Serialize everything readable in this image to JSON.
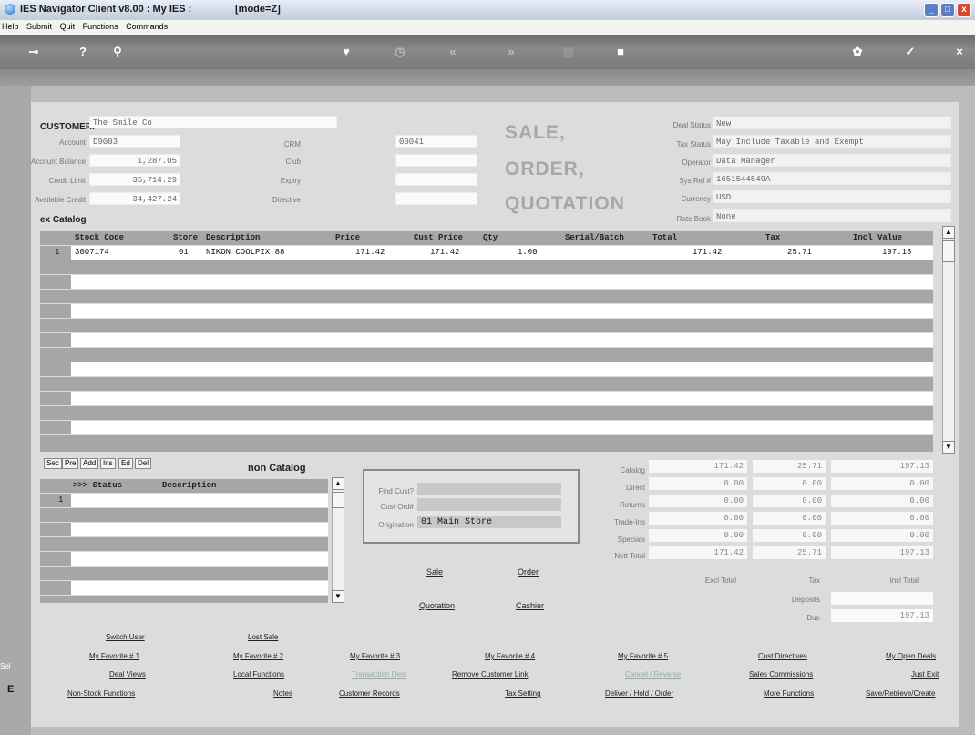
{
  "window": {
    "title": "IES Navigator Client v8.00 : My IES :",
    "mode": "[mode=Z]"
  },
  "menu": [
    "Help",
    "Submit",
    "Quit",
    "Functions",
    "Commands"
  ],
  "toolbar_icons": [
    "key-icon",
    "help-icon",
    "search-icon",
    "heart-icon",
    "clock-icon",
    "first-icon",
    "last-icon",
    "grid-icon",
    "stop-icon",
    "settings-icon",
    "confirm-icon",
    "close-icon"
  ],
  "header": {
    "customer_label": "CUSTOMER:",
    "customer_name": "The Smile Co",
    "account_label": "Account",
    "account": "D9003",
    "account_balance_label": "Account Balance",
    "account_balance": "1,287.05",
    "credit_limit_label": "Credit Limit",
    "credit_limit": "35,714.29",
    "available_credit_label": "Available Credit",
    "available_credit": "34,427.24",
    "crm_label": "CRM",
    "crm": "00041",
    "club_label": "Club",
    "club": "",
    "expiry_label": "Expiry",
    "expiry": "",
    "directive_label": "Directive",
    "directive": "",
    "title_lines": [
      "SALE,",
      "ORDER,",
      "QUOTATION"
    ],
    "deal_status_label": "Deal Status",
    "deal_status": "New",
    "tax_status_label": "Tax Status",
    "tax_status": "May Include Taxable and Exempt",
    "operator_label": "Operator",
    "operator": "Data Manager",
    "sysref_label": "Sys Ref #",
    "sysref": "1651544549A",
    "currency_label": "Currency",
    "currency": "USD",
    "ratebook_label": "Rate Book",
    "ratebook": "None"
  },
  "catalog": {
    "section_label": "ex Catalog",
    "columns": [
      "Stock Code",
      "Store",
      "Description",
      "Price",
      "Cust Price",
      "Qty",
      "Serial/Batch",
      "Total",
      "Tax",
      "Incl Value"
    ],
    "rows": [
      {
        "num": "1",
        "stock_code": "3007174",
        "store": "01",
        "description": "NIKON COOLPIX 88",
        "price": "171.42",
        "cust_price": "171.42",
        "qty": "1.00",
        "serial": "",
        "total": "171.42",
        "tax": "25.71",
        "incl": "197.13"
      }
    ]
  },
  "row_buttons": [
    "Sec",
    "Pre",
    "Add",
    "Ins",
    "Ed",
    "Del"
  ],
  "non_catalog": {
    "section_label": "non Catalog",
    "columns": [
      ">>> Status",
      "Description"
    ],
    "rows": [
      {
        "num": "1",
        "status": "",
        "description": ""
      }
    ]
  },
  "find": {
    "find_cust_label": "Find Cust?",
    "find_cust": "",
    "cust_ord_label": "Cust Ord#",
    "cust_ord": "",
    "origination_label": "Origination",
    "origination": "01 Main Store"
  },
  "actions": {
    "sale": "Sale",
    "order": "Order",
    "quotation": "Quotation",
    "cashier": "Cashier"
  },
  "totals": {
    "rows": [
      {
        "label": "Catalog",
        "excl": "171.42",
        "tax": "25.71",
        "incl": "197.13"
      },
      {
        "label": "Direct",
        "excl": "0.00",
        "tax": "0.00",
        "incl": "0.00"
      },
      {
        "label": "Returns",
        "excl": "0.00",
        "tax": "0.00",
        "incl": "0.00"
      },
      {
        "label": "Trade-Ins",
        "excl": "0.00",
        "tax": "0.00",
        "incl": "0.00"
      },
      {
        "label": "Specials",
        "excl": "0.00",
        "tax": "0.00",
        "incl": "0.00"
      },
      {
        "label": "Nett Total",
        "excl": "171.42",
        "tax": "25.71",
        "incl": "197.13"
      }
    ],
    "excl_label": "Excl Total",
    "tax_label": "Tax",
    "incl_label": "Incl Total",
    "deposits_label": "Deposits",
    "deposits": "",
    "due_label": "Due",
    "due": "197.13"
  },
  "links": {
    "r1": [
      "Switch User",
      "Lost Sale"
    ],
    "r2": [
      "My Favorite # 1",
      "My Favorite # 2",
      "My Favorite # 3",
      "My Favorite # 4",
      "My Favorite # 5",
      "Cust Directives",
      "My Open Deals"
    ],
    "r3": [
      "Deal Views",
      "Local Functions",
      "Transaction Dets",
      "Remove Customer Link",
      "Cancel / Reverse",
      "Sales Commissions",
      "Just Exit"
    ],
    "r4": [
      "Non-Stock Functions",
      "Notes",
      "Customer Records",
      "Tax Setting",
      "Deliver / Hold / Order",
      "More Functions",
      "Save/Retrieve/Create"
    ]
  },
  "side_text": {
    "sel": "Sel",
    "e": "E"
  },
  "colors": {
    "accent": "#a7a7a7",
    "grid_gray": "#a6a6a6",
    "toolbar": "#7a7a7a"
  }
}
